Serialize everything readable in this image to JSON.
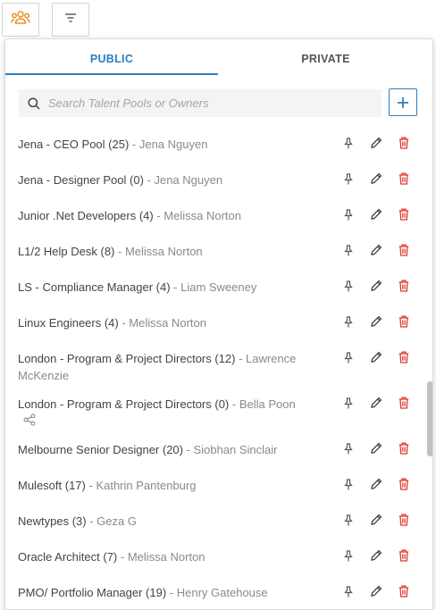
{
  "toolbar": {
    "pools_icon": "people-group-icon",
    "filter_icon": "filter-lines-icon"
  },
  "colors": {
    "accent": "#2e7cc0",
    "danger": "#e0392f",
    "owner": "#8a8a8a",
    "text": "#444444"
  },
  "tabs": {
    "public": "PUBLIC",
    "private": "PRIVATE",
    "active": "public"
  },
  "search": {
    "placeholder": "Search Talent Pools or Owners",
    "value": ""
  },
  "add_icon": "plus-icon",
  "pools": [
    {
      "name": "Jena - CEO Pool (25)",
      "owner": "Jena Nguyen"
    },
    {
      "name": "Jena - Designer Pool (0)",
      "owner": "Jena Nguyen"
    },
    {
      "name": "Junior .Net Developers (4)",
      "owner": "Melissa Norton"
    },
    {
      "name": "L1/2 Help Desk (8)",
      "owner": "Melissa Norton"
    },
    {
      "name": "LS - Compliance Manager (4)",
      "owner": "Liam Sweeney"
    },
    {
      "name": "Linux Engineers (4)",
      "owner": "Melissa Norton"
    },
    {
      "name": "London - Program & Project Directors (12)",
      "owner": "Lawrence McKenzie"
    },
    {
      "name": "London - Program & Project Directors (0)",
      "owner": "Bella Poon",
      "shared": true
    },
    {
      "name": "Melbourne Senior Designer (20)",
      "owner": "Siobhan Sinclair"
    },
    {
      "name": "Mulesoft (17)",
      "owner": "Kathrin Pantenburg"
    },
    {
      "name": "Newtypes (3)",
      "owner": "Geza G"
    },
    {
      "name": "Oracle Architect (7)",
      "owner": "Melissa Norton"
    },
    {
      "name": "PMO/ Portfolio Manager (19)",
      "owner": "Henry Gatehouse"
    }
  ]
}
